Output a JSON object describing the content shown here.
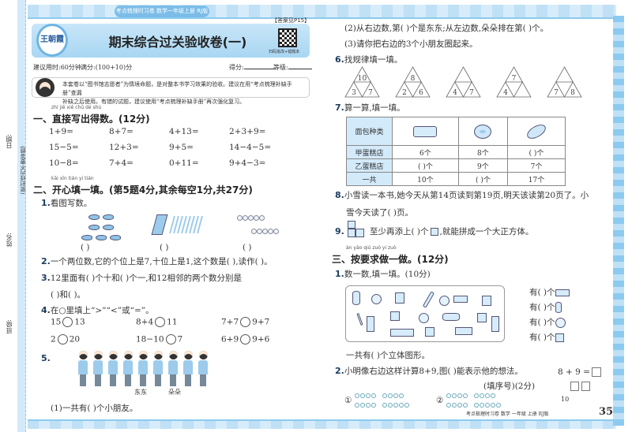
{
  "banner": "考点梳理时习卷  数学一年级上册  RJ版",
  "answer_ref": "【答案见P15】",
  "logo_text": "王朝霞",
  "title": "期末综合过关验收卷(一)",
  "qr_label": "扫码批改+错题本",
  "meta": {
    "time": "建议用时:60分钟",
    "full": "满分:(100+10)分",
    "score": "得分:",
    "grade": "等级:"
  },
  "notice": [
    "本套卷以“图书馆志愿者”为情境命题，是对整本书学习效果的验收。建议在用“考点梳理补缺手册”查漏",
    "补缺之后使用。有错的试题，建议使用“考点梳理补缺手册”再次强化复习。"
  ],
  "margin": {
    "date": "日期:",
    "seal": "(密封线内不要答题)",
    "name": "姓名:",
    "class": "班级:"
  },
  "s1": {
    "pinyin": "zhí jiē xiě chū dé shù",
    "title": "一、直接写出得数。(12分)",
    "problems": [
      [
        "1+9=",
        "8+7=",
        "4+13=",
        "2+3+9="
      ],
      [
        "15−5=",
        "12+3=",
        "9+5=",
        "14−4−5="
      ],
      [
        "10−8=",
        "7+4=",
        "0+11=",
        "9+4−3="
      ]
    ]
  },
  "s2": {
    "pinyin": "kāi xīn tián yi tián",
    "title": "二、开心填一填。(第5题4分,其余每空1分,共27分)",
    "q1": {
      "n": "1.",
      "text": "看图写数。",
      "blank": "(        )"
    },
    "q2": {
      "n": "2.",
      "text": "一个两位数,它的个位上是7,十位上是1,这个数是(        ),读作(        )。"
    },
    "q3": {
      "n": "3.",
      "text": "12里面有(        )个十和(        )个一,和12相邻的两个数分别是",
      "text2": "(        )和(        )。"
    },
    "q4": {
      "n": "4.",
      "text": "在○里填上“>”“<”或“=”。",
      "items": [
        [
          "15",
          "13"
        ],
        [
          "8+4",
          "11"
        ],
        [
          "7+7",
          "9+7"
        ],
        [
          "2",
          "20"
        ],
        [
          "18−10",
          "7"
        ],
        [
          "6+9",
          "9+6"
        ]
      ]
    },
    "q5": {
      "n": "5.",
      "dongdong": "东东",
      "duoduo": "朵朵",
      "p1": "(1)一共有(        )个小朋友。",
      "p2": "(2)从右边数,第(        )个是东东;从左边数,朵朵排在第(        )个。",
      "p3": "(3)请你把右边的3个小朋友圈起来。"
    },
    "q6": {
      "n": "6.",
      "text": "找规律填一填。",
      "triangles": [
        [
          "10",
          "3",
          "7"
        ],
        [
          "8",
          "2",
          "6"
        ],
        [
          "",
          "4",
          "7"
        ],
        [
          "7",
          "4",
          ""
        ],
        [
          "",
          "7",
          "8"
        ]
      ]
    },
    "q7": {
      "n": "7.",
      "text": "算一算,填一填。",
      "table": {
        "header": "面包种类",
        "rows": [
          [
            "甲蛋糕店",
            "6个",
            "8个",
            "(        )个"
          ],
          [
            "乙蛋糕店",
            "(        )个",
            "9个",
            "7个"
          ],
          [
            "一共",
            "10个",
            "(        )个",
            "17个"
          ]
        ]
      }
    },
    "q8": {
      "n": "8.",
      "text": "小雪读一本书,她今天从第14页读到第19页,明天该读第20页了。小",
      "text2": "雪今天读了(        )页。"
    },
    "q9": {
      "n": "9.",
      "text": "至少再添上(        )个",
      "text2": ",就能拼成一个大正方体。"
    }
  },
  "s3": {
    "pinyin": "àn yāo qiú zuò yi zuò",
    "title": "三、按要求做一做。(12分)",
    "q1": {
      "n": "1.",
      "text": "数一数,填一填。(10分)",
      "rows": [
        "有(        )个",
        "有(        )个",
        "有(        )个",
        "有(        )个"
      ],
      "total": "一共有(        )个立体图形。"
    },
    "q2": {
      "n": "2.",
      "text": "小明像右边这样计算8+9,图(        )能表示他的想法。",
      "hint": "(填序号)(2分)",
      "eq": "8 + 9 =",
      "ten": "10",
      "opt1": "①",
      "opt2": "②"
    }
  },
  "footer": {
    "text": "考点梳理时习卷  数学  一年级  上册  RJ版",
    "page": "35"
  }
}
